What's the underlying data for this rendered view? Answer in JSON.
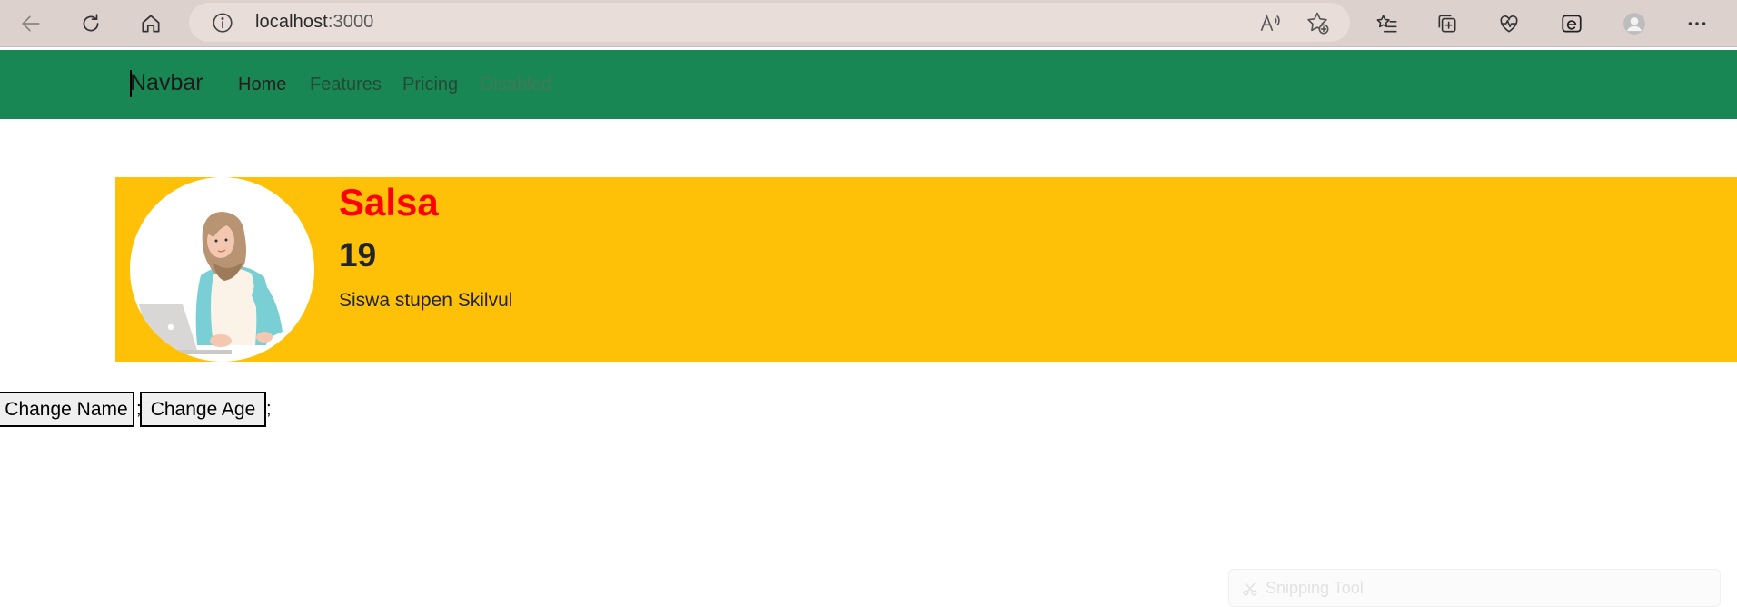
{
  "browser": {
    "url_host": "localhost",
    "url_port": ":3000"
  },
  "navbar": {
    "brand": "Navbar",
    "links": [
      {
        "label": "Home"
      },
      {
        "label": "Features"
      },
      {
        "label": "Pricing"
      },
      {
        "label": "Disabled"
      }
    ],
    "background_color": "#198754"
  },
  "profile": {
    "name": "Salsa",
    "age": "19",
    "description": "Siswa stupen Skilvul",
    "name_color": "#ff0000",
    "card_color": "#ffc107"
  },
  "actions": {
    "change_name_label": "Change Name",
    "change_age_label": "Change Age",
    "separator": ";"
  },
  "overlay": {
    "snipping_tool_label": "Snipping Tool"
  }
}
